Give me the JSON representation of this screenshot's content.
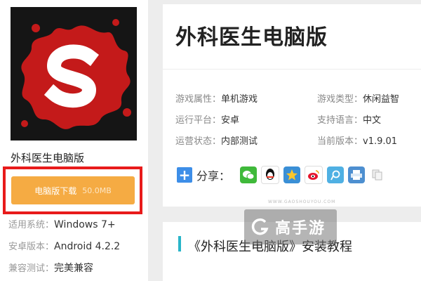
{
  "sidebar": {
    "app_name": "外科医生电脑版",
    "download_label": "电脑版下载",
    "download_size": "50.0MB",
    "specs": [
      {
        "key": "适用系统：",
        "value": "Windows 7+"
      },
      {
        "key": "安卓版本：",
        "value": "Android 4.2.2"
      },
      {
        "key": "兼容测试：",
        "value": "完美兼容"
      }
    ]
  },
  "info": {
    "title": "外科医生电脑版",
    "attrs": [
      {
        "key": "游戏属性：",
        "value": "单机游戏"
      },
      {
        "key": "游戏类型：",
        "value": "休闲益智"
      },
      {
        "key": "运行平台：",
        "value": "安卓"
      },
      {
        "key": "支持语言：",
        "value": "中文"
      },
      {
        "key": "运营状态：",
        "value": "内部测试"
      },
      {
        "key": "当前版本：",
        "value": "v1.9.01"
      }
    ],
    "share_label": "分享：",
    "share_icons": [
      "wechat-icon",
      "qq-icon",
      "qzone-star-icon",
      "weibo-icon",
      "tencent-weibo-icon",
      "print-icon",
      "copy-icon"
    ]
  },
  "article": {
    "title": "《外科医生电脑版》安装教程"
  },
  "watermark": {
    "text": "高手游",
    "sub": "WWW.GAOSHOUYOU.COM"
  },
  "colors": {
    "download_button": "#f5ab43",
    "highlight_frame": "#e81b1b",
    "accent": "#29b5c9",
    "icon_red": "#c41a1a"
  }
}
